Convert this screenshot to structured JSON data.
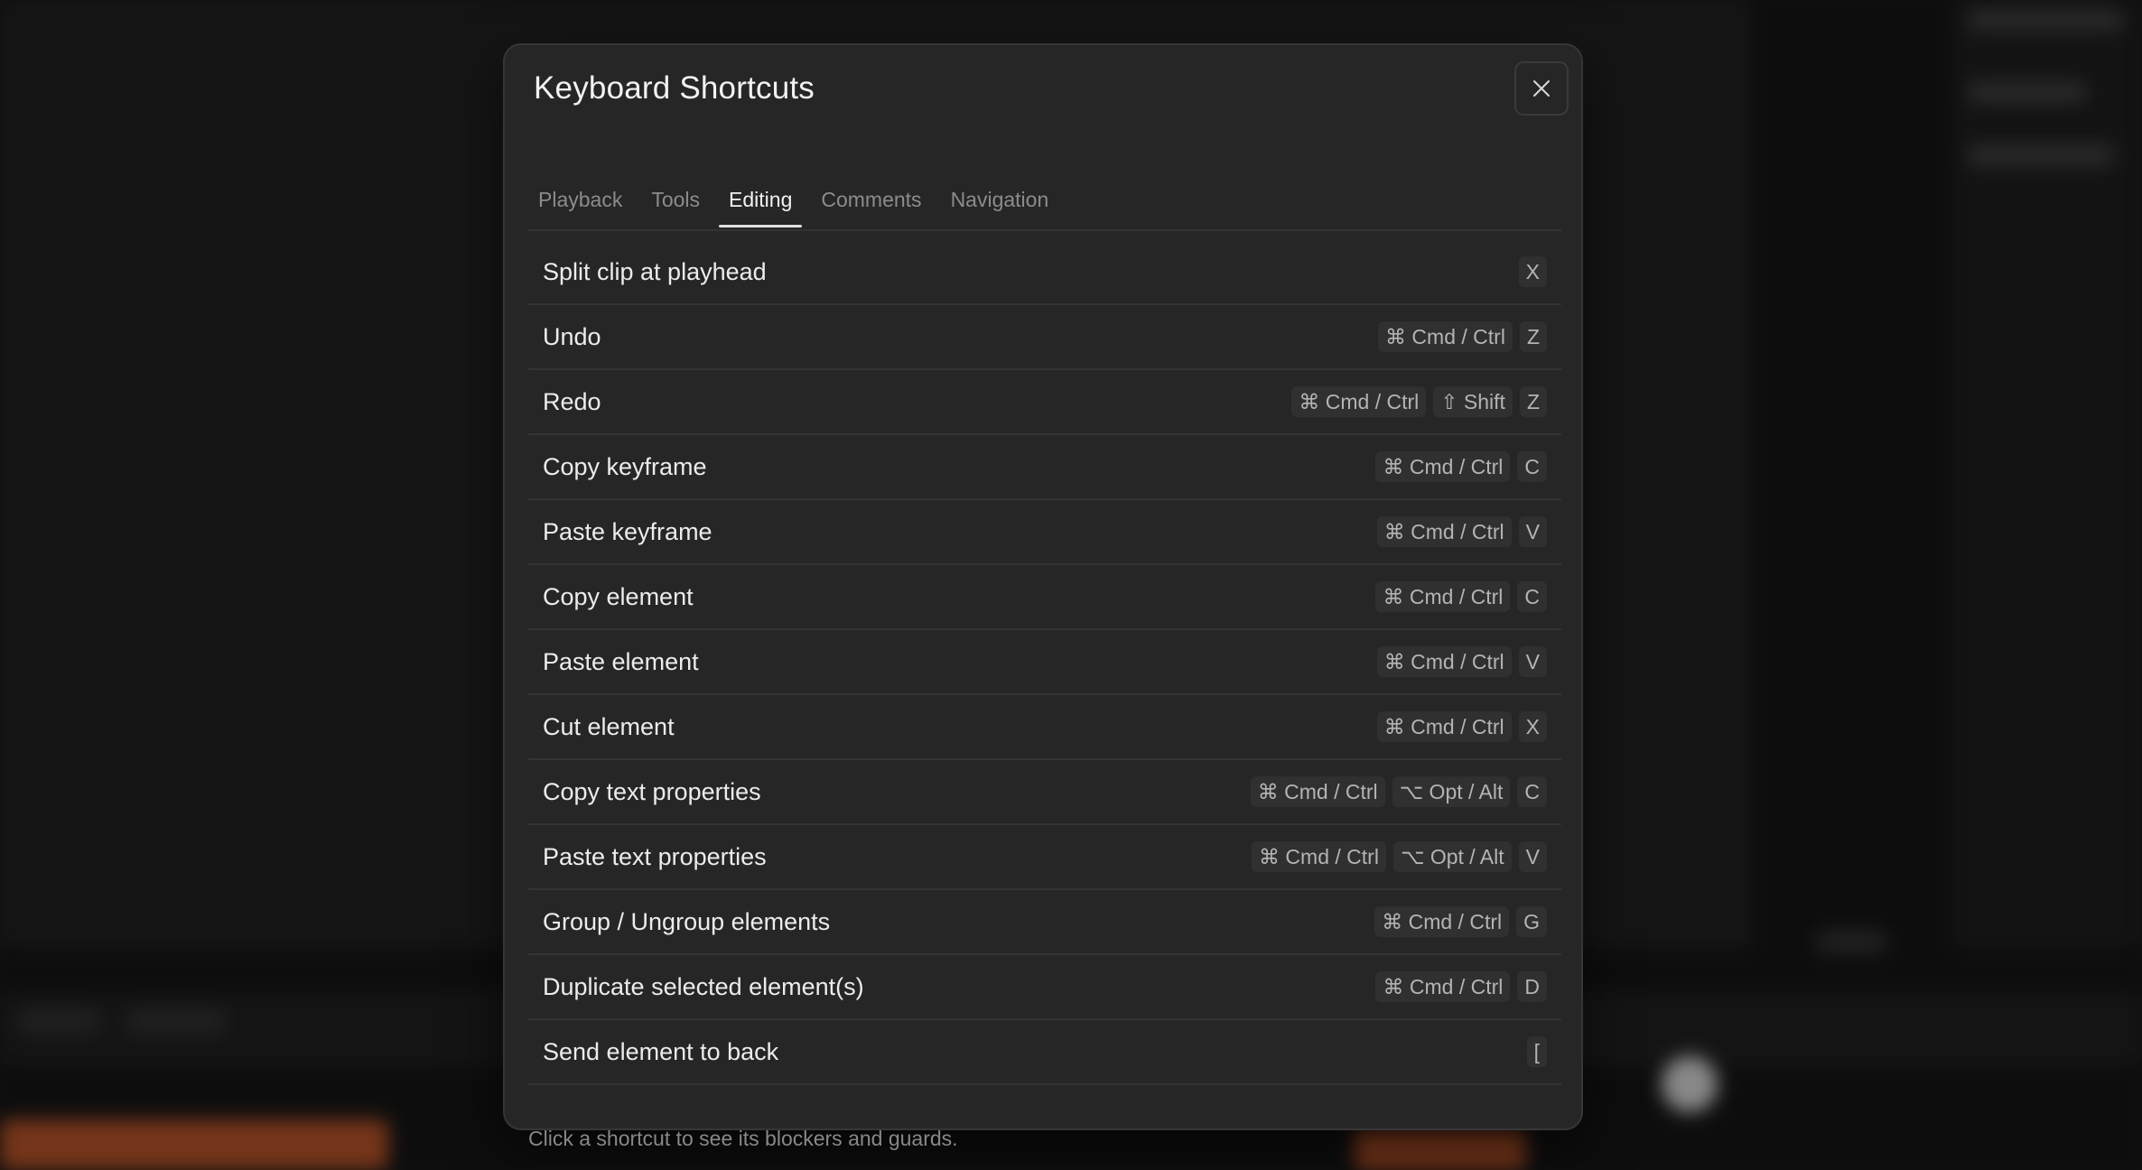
{
  "modal": {
    "title": "Keyboard Shortcuts",
    "close_icon": "close-icon"
  },
  "tabs": [
    {
      "label": "Playback",
      "active": false
    },
    {
      "label": "Tools",
      "active": false
    },
    {
      "label": "Editing",
      "active": true
    },
    {
      "label": "Comments",
      "active": false
    },
    {
      "label": "Navigation",
      "active": false
    }
  ],
  "shortcuts": [
    {
      "label": "Split clip at playhead",
      "keys": [
        "X"
      ]
    },
    {
      "label": "Undo",
      "keys": [
        "⌘ Cmd / Ctrl",
        "Z"
      ]
    },
    {
      "label": "Redo",
      "keys": [
        "⌘ Cmd / Ctrl",
        "⇧ Shift",
        "Z"
      ]
    },
    {
      "label": "Copy keyframe",
      "keys": [
        "⌘ Cmd / Ctrl",
        "C"
      ]
    },
    {
      "label": "Paste keyframe",
      "keys": [
        "⌘ Cmd / Ctrl",
        "V"
      ]
    },
    {
      "label": "Copy element",
      "keys": [
        "⌘ Cmd / Ctrl",
        "C"
      ]
    },
    {
      "label": "Paste element",
      "keys": [
        "⌘ Cmd / Ctrl",
        "V"
      ]
    },
    {
      "label": "Cut element",
      "keys": [
        "⌘ Cmd / Ctrl",
        "X"
      ]
    },
    {
      "label": "Copy text properties",
      "keys": [
        "⌘ Cmd / Ctrl",
        "⌥ Opt / Alt",
        "C"
      ]
    },
    {
      "label": "Paste text properties",
      "keys": [
        "⌘ Cmd / Ctrl",
        "⌥ Opt / Alt",
        "V"
      ]
    },
    {
      "label": "Group / Ungroup elements",
      "keys": [
        "⌘ Cmd / Ctrl",
        "G"
      ]
    },
    {
      "label": "Duplicate selected element(s)",
      "keys": [
        "⌘ Cmd / Ctrl",
        "D"
      ]
    },
    {
      "label": "Send element to back",
      "keys": [
        "["
      ]
    }
  ],
  "footer": {
    "hint": "Click a shortcut to see its blockers and guards."
  },
  "colors": {
    "modal_bg": "#262626",
    "divider": "#333333",
    "active_tab": "#f2f2f2",
    "inactive_tab": "#8c8c8c",
    "kbd_bg": "#303030",
    "timeline_clip": "#a24a24"
  }
}
